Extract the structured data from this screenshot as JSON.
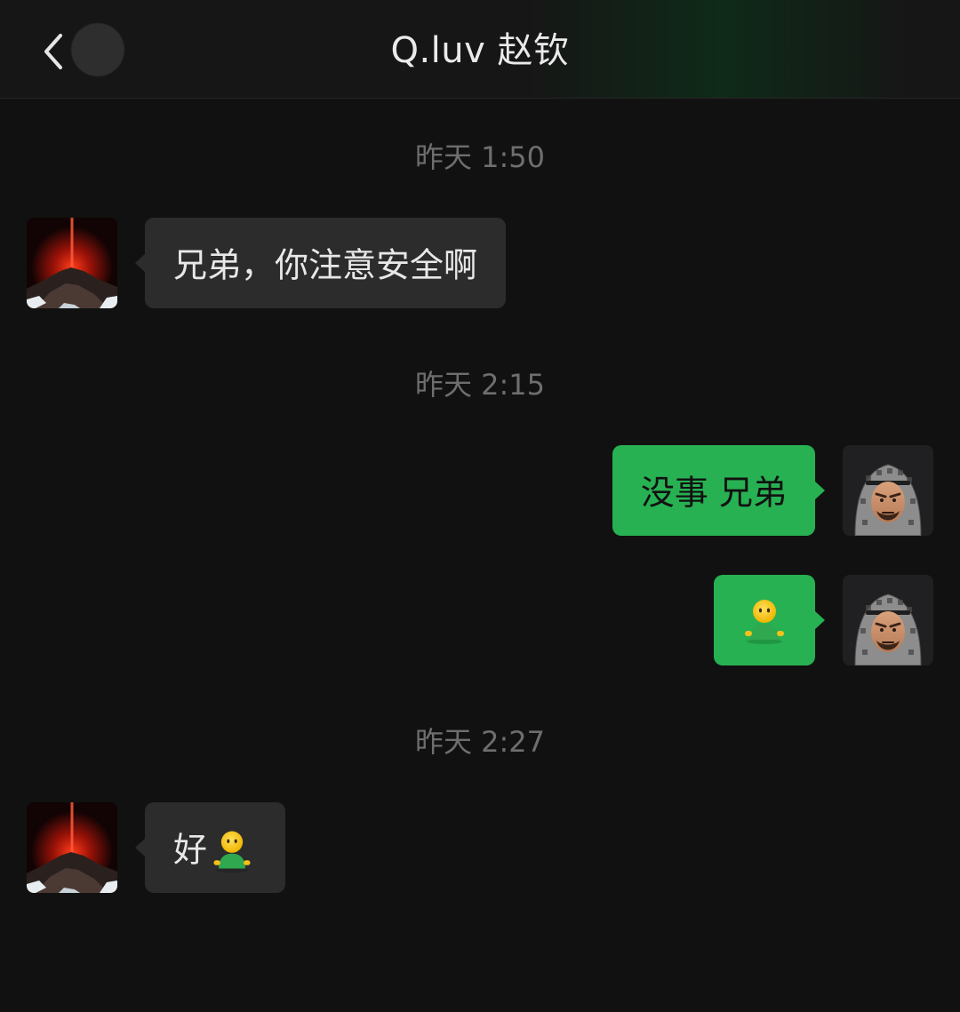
{
  "header": {
    "title": "Q.luv 赵钦"
  },
  "messages": [
    {
      "type": "timestamp",
      "text": "昨天 1:50"
    },
    {
      "type": "incoming",
      "text": "兄弟，你注意安全啊"
    },
    {
      "type": "timestamp",
      "text": "昨天 2:15"
    },
    {
      "type": "outgoing",
      "text": "没事 兄弟"
    },
    {
      "type": "outgoing",
      "text": "",
      "icon": "standing-person-emoji-icon"
    },
    {
      "type": "timestamp",
      "text": "昨天 2:27"
    },
    {
      "type": "incoming",
      "text": "好",
      "icon": "standing-person-emoji-icon"
    }
  ],
  "colors": {
    "background": "#111111",
    "incoming_bubble": "#2c2c2c",
    "outgoing_bubble": "#27b152",
    "timestamp": "#6e6e6e"
  },
  "icons": {
    "back": "back-chevron-icon",
    "contact_avatar": "volcano-avatar",
    "self_avatar": "memoji-keffiyeh-avatar",
    "emoji": "standing-person-emoji-icon"
  }
}
